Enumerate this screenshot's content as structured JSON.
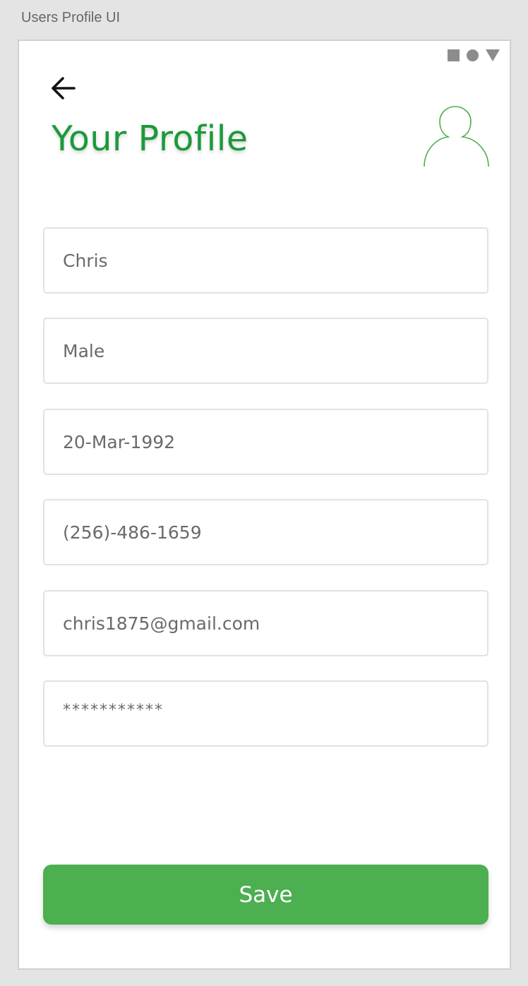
{
  "frame": {
    "title": "Users Profile UI"
  },
  "header": {
    "title": "Your Profile"
  },
  "form": {
    "fields": [
      {
        "name": "name",
        "value": "Chris"
      },
      {
        "name": "gender",
        "value": "Male"
      },
      {
        "name": "date-of-birth",
        "value": "20-Mar-1992"
      },
      {
        "name": "phone",
        "value": "(256)-486-1659"
      },
      {
        "name": "email",
        "value": "chris1875@gmail.com"
      },
      {
        "name": "password",
        "value": "***********"
      }
    ],
    "save_label": "Save"
  },
  "icons": {
    "back": "arrow-left-icon",
    "avatar": "user-avatar-icon",
    "status": [
      "square-icon",
      "circle-icon",
      "triangle-down-icon"
    ]
  },
  "colors": {
    "accent": "#1a9a3a",
    "button": "#4caf50",
    "avatar_stroke": "#4caf50"
  }
}
